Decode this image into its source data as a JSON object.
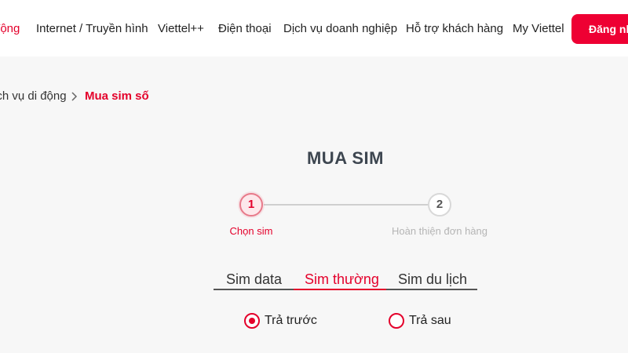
{
  "nav": {
    "items": [
      {
        "label": "động"
      },
      {
        "label": "Internet / Truyền hình"
      },
      {
        "label": "Viettel++"
      },
      {
        "label": "Điện thoại"
      },
      {
        "label": "Dịch vụ doanh nghiệp"
      },
      {
        "label": "Hỗ trợ khách hàng"
      },
      {
        "label": "My Viettel"
      }
    ],
    "login_label": "Đăng nhập"
  },
  "breadcrumb": {
    "items": [
      "ịch vụ di động",
      "Mua sim số"
    ]
  },
  "page": {
    "title": "MUA SIM"
  },
  "steps": [
    {
      "number": "1",
      "label": "Chọn sim"
    },
    {
      "number": "2",
      "label": "Hoàn thiện đơn hàng"
    }
  ],
  "tabs": [
    {
      "label": "Sim data"
    },
    {
      "label": "Sim thường"
    },
    {
      "label": "Sim du lịch"
    }
  ],
  "payment_options": [
    {
      "label": "Trả trước",
      "selected": true
    },
    {
      "label": "Trả sau",
      "selected": false
    }
  ],
  "colors": {
    "accent": "#e4002b",
    "button": "#ee0033",
    "title": "#3d4650",
    "background": "#f7f7f7"
  },
  "icons": {
    "breadcrumb_separator": "chevron-right-icon"
  }
}
